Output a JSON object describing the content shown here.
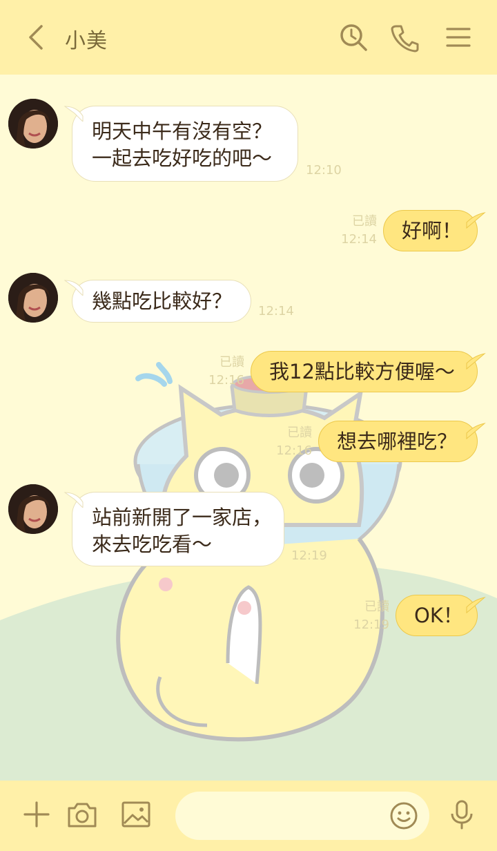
{
  "header": {
    "title": "小美",
    "back_icon": "chevron-left-icon",
    "search_icon": "search-icon",
    "call_icon": "phone-icon",
    "menu_icon": "menu-icon"
  },
  "messages": [
    {
      "direction": "incoming",
      "lines": [
        "明天中午有沒有空？",
        "一起去吃好吃的吧～"
      ],
      "time": "12:10"
    },
    {
      "direction": "outgoing",
      "lines": [
        "好啊！"
      ],
      "read": "已讀",
      "time": "12:14"
    },
    {
      "direction": "incoming",
      "lines": [
        "幾點吃比較好？"
      ],
      "time": "12:14"
    },
    {
      "direction": "outgoing",
      "lines": [
        "我12點比較方便喔～"
      ],
      "read": "已讀",
      "time": "12:16"
    },
    {
      "direction": "outgoing",
      "lines": [
        "想去哪裡吃？"
      ],
      "read": "已讀",
      "time": "12:16"
    },
    {
      "direction": "incoming",
      "lines": [
        "站前新開了一家店，",
        "來去吃吃看～"
      ],
      "time": "12:19"
    },
    {
      "direction": "outgoing",
      "lines": [
        "OK！"
      ],
      "read": "已讀",
      "time": "12:19"
    }
  ],
  "composer": {
    "placeholder": "",
    "add_icon": "plus-icon",
    "camera_icon": "camera-icon",
    "image_icon": "image-icon",
    "emoji_icon": "smiley-icon",
    "mic_icon": "microphone-icon"
  },
  "colors": {
    "header_bg": "#fff0a8",
    "chat_bg": "#fffbd6",
    "outgoing_bubble": "#ffe680",
    "incoming_bubble": "#ffffff",
    "icon": "#a08a55"
  }
}
